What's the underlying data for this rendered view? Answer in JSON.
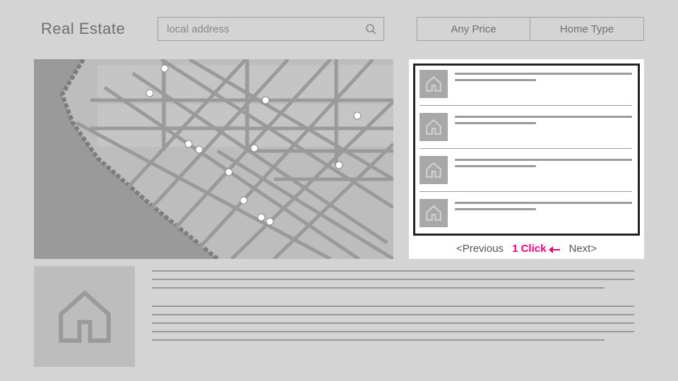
{
  "header": {
    "brand": "Real Estate",
    "search_placeholder": "local address",
    "filters": {
      "price": "Any Price",
      "home_type": "Home Type"
    }
  },
  "pager": {
    "prev": "<Previous",
    "click_annotation": "1 Click",
    "next": "Next>"
  },
  "listings": [
    {
      "icon": "house-icon"
    },
    {
      "icon": "house-icon"
    },
    {
      "icon": "house-icon"
    },
    {
      "icon": "house-icon"
    },
    {
      "icon": "house-icon"
    }
  ]
}
